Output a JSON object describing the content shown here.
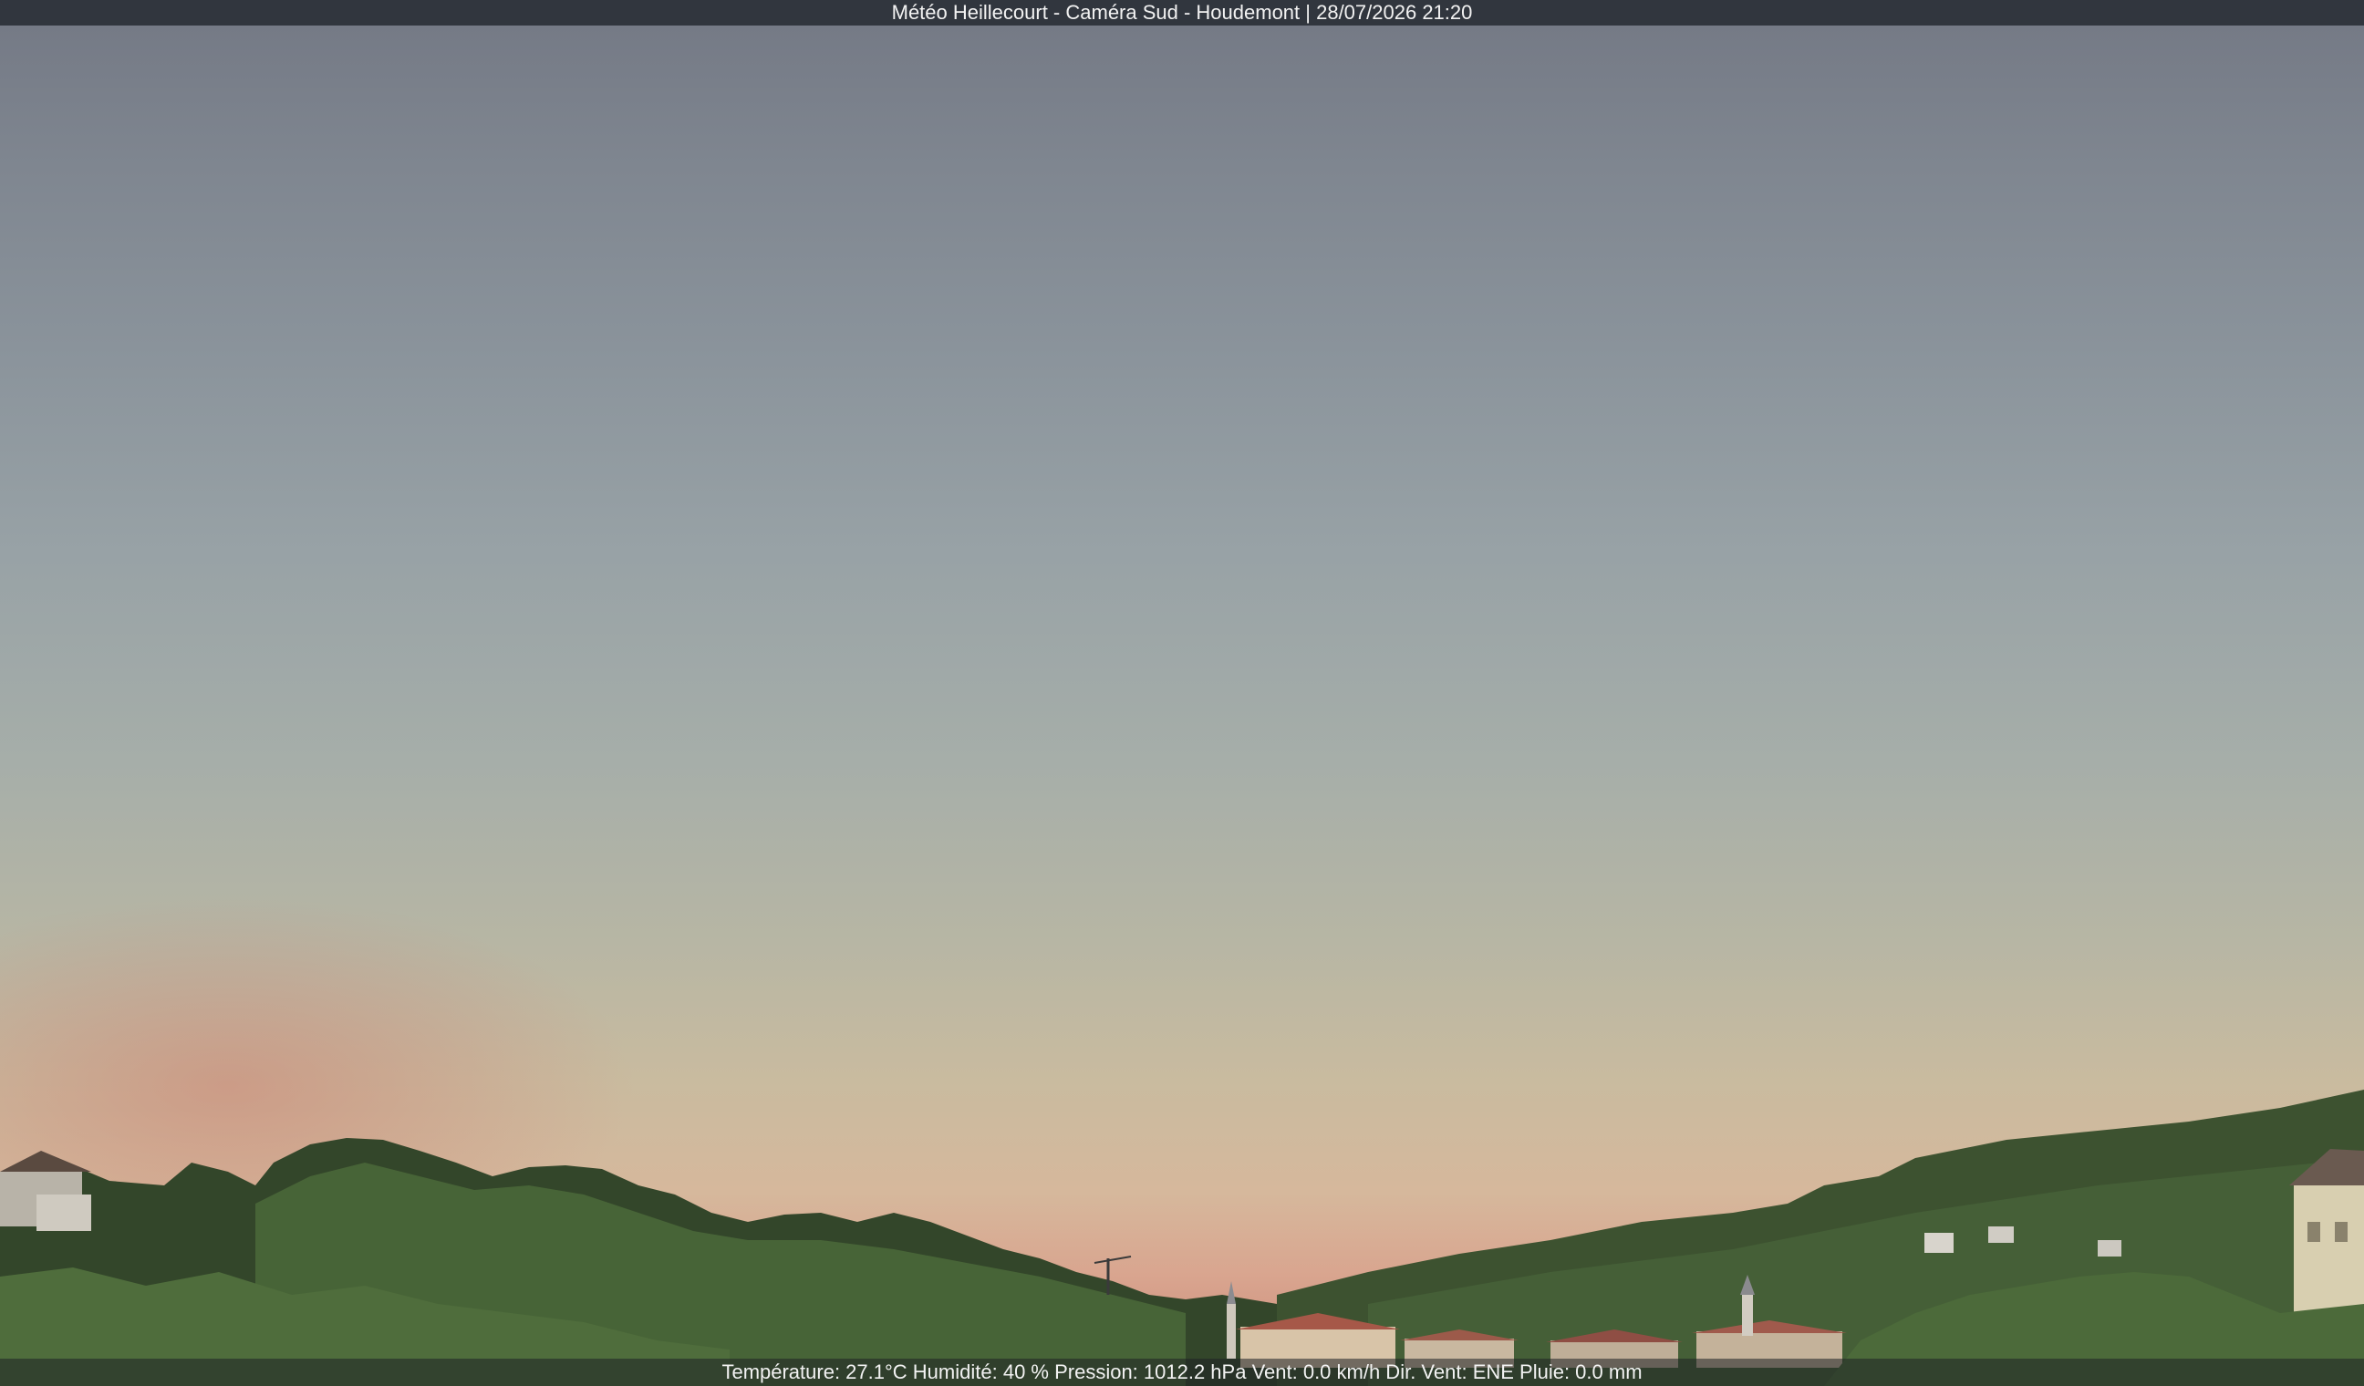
{
  "header": {
    "title": "Météo Heillecourt - Caméra Sud - Houdemont | 28/07/2026 21:20"
  },
  "footer": {
    "readout": "Température: 27.1°C  Humidité: 40 % Pression: 1012.2 hPa Vent: 0.0 km/h Dir. Vent: ENE Pluie: 0.0 mm"
  },
  "colors": {
    "overlay_bar": "#282c34",
    "overlay_text": "#f2f2f2",
    "sky_top": "#737884",
    "sky_horizon": "#d6b89c",
    "foliage": "#3f5a2e"
  }
}
